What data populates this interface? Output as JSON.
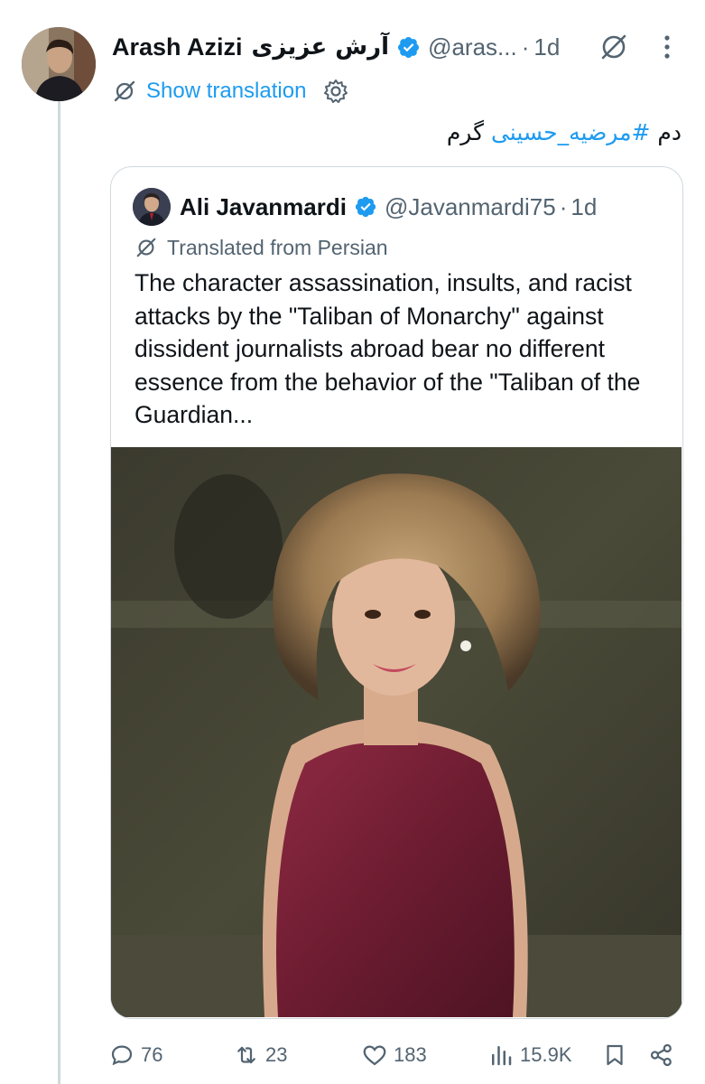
{
  "tweet": {
    "author_name": "Arash Azizi",
    "author_name_fa": "آرش عزیزی",
    "handle": "@aras...",
    "separator": "·",
    "time": "1d",
    "translate_label": "Show translation",
    "text_prefix": "دم ",
    "hashtag": "#مرضیه_حسینی",
    "text_suffix": " گرم"
  },
  "quote": {
    "author_name": "Ali Javanmardi",
    "handle": "@Javanmardi75",
    "separator": "·",
    "time": "1d",
    "translated_label": "Translated from Persian",
    "body": "The character assassination, insults, and racist attacks by the \"Taliban of Monarchy\" against dissident journalists abroad bear no different essence from the behavior of the \"Taliban of the Guardian..."
  },
  "actions": {
    "replies": "76",
    "reposts": "23",
    "likes": "183",
    "views": "15.9K"
  },
  "icons": {
    "verified": "verified-badge-icon",
    "grok": "grok-icon",
    "more": "more-icon",
    "translate": "translate-icon",
    "settings": "gear-icon",
    "reply": "reply-icon",
    "repost": "repost-icon",
    "like": "heart-icon",
    "views": "views-icon",
    "bookmark": "bookmark-icon",
    "share": "share-icon"
  },
  "colors": {
    "accent": "#1d9bf0",
    "secondary_text": "#536471",
    "border": "#cfd9de"
  }
}
